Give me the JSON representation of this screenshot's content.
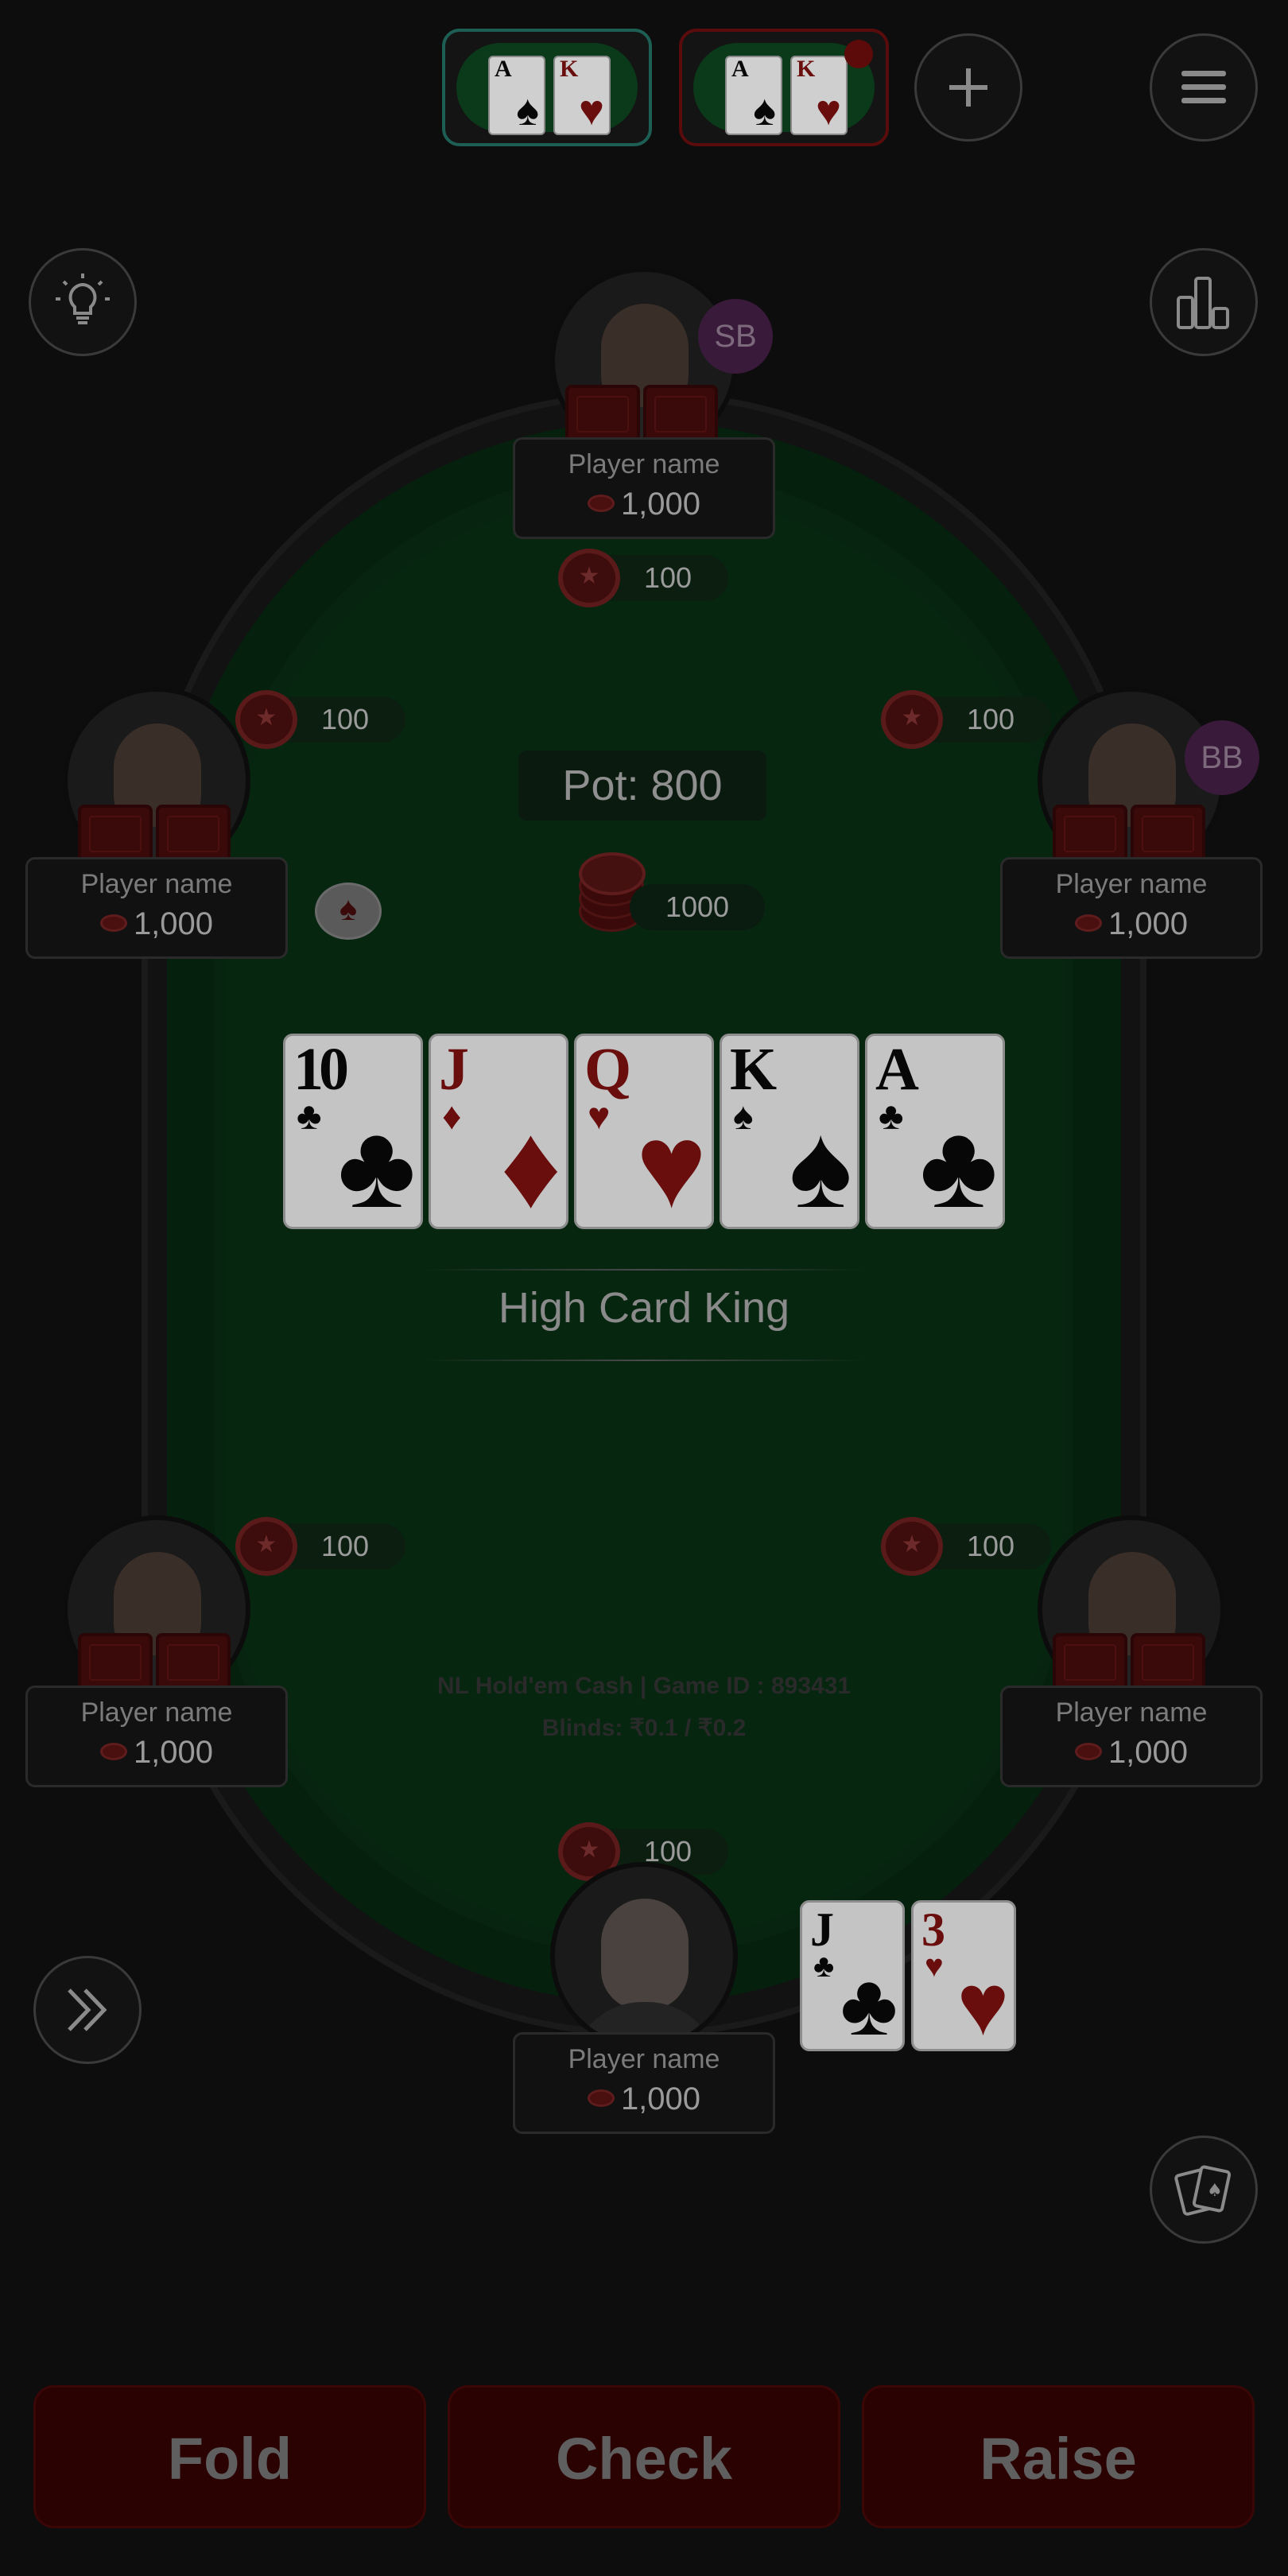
{
  "top_bar": {
    "tables": [
      {
        "cards": [
          {
            "rank": "A",
            "suit": "♠"
          },
          {
            "rank": "K",
            "suit": "♥"
          }
        ],
        "active": true
      },
      {
        "cards": [
          {
            "rank": "A",
            "suit": "♠"
          },
          {
            "rank": "K",
            "suit": "♥"
          }
        ],
        "active": false,
        "notification": true
      }
    ],
    "add_icon": "plus-icon",
    "menu_icon": "hamburger-menu-icon"
  },
  "side_icons": {
    "hint": "lightbulb-icon",
    "stats": "bar-chart-icon",
    "fast_forward": "double-chevron-right-icon",
    "cards": "playing-cards-icon"
  },
  "pot": {
    "label": "Pot: 800",
    "stack_amount": "1000"
  },
  "players": [
    {
      "seat": "top",
      "name": "Player name",
      "chips": "1,000",
      "badge": "SB",
      "bet": "100"
    },
    {
      "seat": "upper-left",
      "name": "Player name",
      "chips": "1,000",
      "bet": "100"
    },
    {
      "seat": "upper-right",
      "name": "Player name",
      "chips": "1,000",
      "badge": "BB",
      "bet": "100"
    },
    {
      "seat": "lower-left",
      "name": "Player name",
      "chips": "1,000",
      "bet": "100"
    },
    {
      "seat": "lower-right",
      "name": "Player name",
      "chips": "1,000",
      "bet": "100"
    },
    {
      "seat": "bottom",
      "name": "Player name",
      "chips": "1,000",
      "bet": "100"
    }
  ],
  "community_cards": [
    {
      "rank": "10",
      "suit": "♣",
      "color": "black"
    },
    {
      "rank": "J",
      "suit": "♦",
      "color": "red"
    },
    {
      "rank": "Q",
      "suit": "♥",
      "color": "red"
    },
    {
      "rank": "K",
      "suit": "♠",
      "color": "black"
    },
    {
      "rank": "A",
      "suit": "♣",
      "color": "black"
    }
  ],
  "hand_result": "High Card King",
  "game_info": {
    "line1": "NL Hold'em Cash | Game ID : 893431",
    "line2": "Blinds: ₹0.1 / ₹0.2"
  },
  "hero_cards": [
    {
      "rank": "J",
      "suit": "♣",
      "color": "black"
    },
    {
      "rank": "3",
      "suit": "♥",
      "color": "red"
    }
  ],
  "actions": {
    "fold": "Fold",
    "check": "Check",
    "raise": "Raise"
  }
}
